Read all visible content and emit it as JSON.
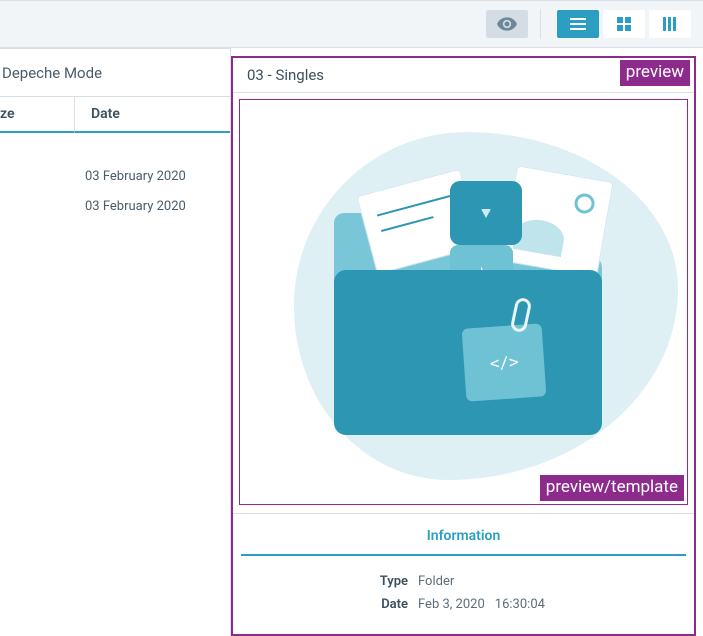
{
  "toolbar": {
    "eye_icon": "eye",
    "views": [
      "list",
      "grid",
      "columns"
    ],
    "active_view": 0
  },
  "left": {
    "breadcrumb": "Depeche Mode",
    "columns": {
      "size": "ze",
      "date": "Date"
    },
    "rows": [
      {
        "size": "",
        "date": "03 February 2020"
      },
      {
        "size": "",
        "date": "03 February 2020"
      }
    ]
  },
  "preview": {
    "title": "03 - Singles",
    "tag_top": "preview",
    "tag_bottom": "preview/template",
    "info_heading": "Information",
    "info": {
      "type_label": "Type",
      "type_value": "Folder",
      "date_label": "Date",
      "date_value": "Feb 3, 2020",
      "time_value": "16:30:04"
    }
  }
}
